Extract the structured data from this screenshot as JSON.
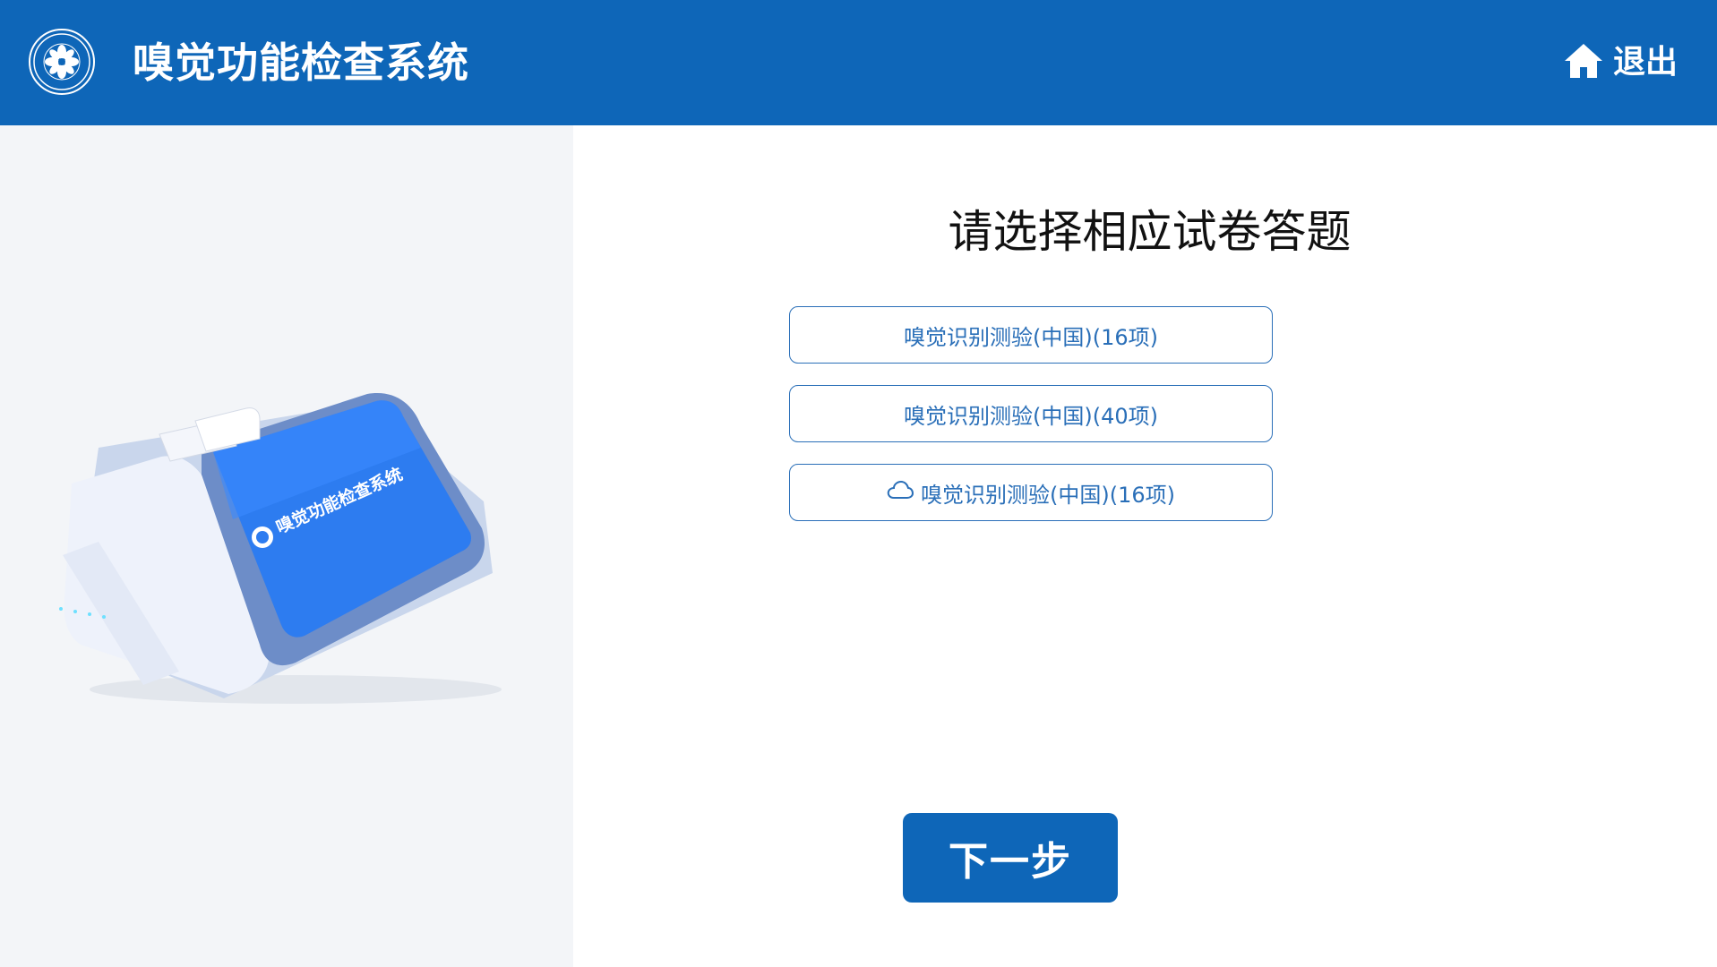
{
  "header": {
    "title": "嗅觉功能检查系统",
    "exit_label": "退出",
    "logo_icon": "institution-seal-icon",
    "exit_icon": "home-icon"
  },
  "left_panel": {
    "device_screen_text": "嗅觉功能检查系统"
  },
  "main": {
    "prompt": "请选择相应试卷答题",
    "options": [
      {
        "label": "嗅觉识别测验(中国)(16项)",
        "icon": ""
      },
      {
        "label": "嗅觉识别测验(中国)(40项)",
        "icon": ""
      },
      {
        "label": "嗅觉识别测验(中国)(16项)",
        "icon": "cloud-icon"
      }
    ],
    "next_label": "下一步"
  },
  "colors": {
    "brand": "#0e66b8",
    "option_border": "#2a6fb8",
    "left_panel_bg": "#f3f5f8"
  }
}
